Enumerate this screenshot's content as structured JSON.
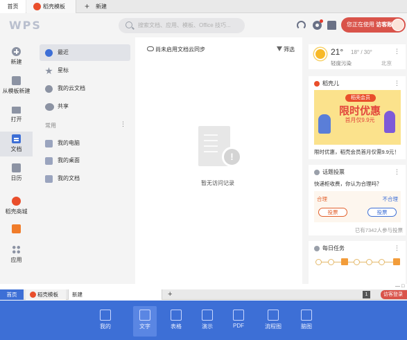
{
  "top_tabs": {
    "home": "首页",
    "template": "稻壳模板",
    "new": "新建"
  },
  "header": {
    "logo": "WPS",
    "search_placeholder": "搜索文档、应用、模板、Office 技巧...",
    "user_prefix": "您正在使用",
    "user_name": "访客账号"
  },
  "left_nav": [
    {
      "label": "新建",
      "icon": "plus-icon"
    },
    {
      "label": "从模板新建",
      "icon": "template-icon"
    },
    {
      "label": "打开",
      "icon": "folder-icon"
    },
    {
      "label": "文档",
      "icon": "document-icon",
      "active": true
    },
    {
      "label": "日历",
      "icon": "calendar-icon"
    },
    {
      "label": "稻壳商城",
      "icon": "shop-icon"
    },
    {
      "label": "",
      "icon": "video-icon"
    },
    {
      "label": "应用",
      "icon": "apps-icon"
    }
  ],
  "sub_nav": {
    "items": [
      {
        "label": "最近",
        "icon": "clock-icon",
        "active": true
      },
      {
        "label": "星标",
        "icon": "star-icon"
      },
      {
        "label": "我的云文档",
        "icon": "cloud-doc-icon"
      },
      {
        "label": "共享",
        "icon": "share-icon"
      }
    ],
    "section_label": "常用",
    "common": [
      {
        "label": "我的电脑",
        "icon": "computer-icon"
      },
      {
        "label": "我的桌面",
        "icon": "desktop-icon"
      },
      {
        "label": "我的文档",
        "icon": "my-documents-icon"
      }
    ]
  },
  "main": {
    "sync_notice": "尚未启用文档云同步",
    "filter": "筛选",
    "empty_text": "暂无访问记录"
  },
  "weather": {
    "temp": "21°",
    "range": "18° / 30°",
    "quality": "轻度污染",
    "city": "北京"
  },
  "promo": {
    "title": "稻壳儿",
    "pill": "稻壳会员",
    "headline": "限时优惠",
    "sub": "首月仅9.9元",
    "caption": "限时优惠，稻壳会员首月仅需9.9元！"
  },
  "vote": {
    "title": "话题投票",
    "question": "快递柜收费，你认为合理吗？",
    "left": "合理",
    "right": "不合理",
    "button": "投票",
    "count": "已有7342人参与投票"
  },
  "tasks": {
    "title": "每日任务"
  },
  "bottom_tabs": {
    "home": "首页",
    "template": "稻壳模板",
    "new": "新建",
    "page_num": "1",
    "user": "访客登录"
  },
  "toolbar": [
    {
      "label": "我的",
      "icon": "star-icon"
    },
    {
      "label": "文字",
      "icon": "document-icon",
      "active": true
    },
    {
      "label": "表格",
      "icon": "spreadsheet-icon"
    },
    {
      "label": "演示",
      "icon": "presentation-icon"
    },
    {
      "label": "PDF",
      "icon": "pdf-icon"
    },
    {
      "label": "流程图",
      "icon": "flowchart-icon"
    },
    {
      "label": "脑图",
      "icon": "mindmap-icon"
    }
  ]
}
